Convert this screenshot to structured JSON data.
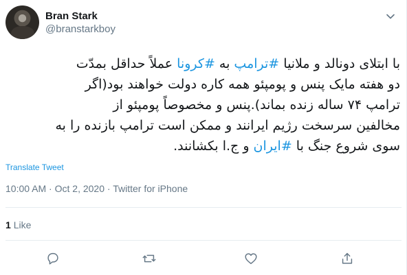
{
  "user": {
    "display_name": "Bran Stark",
    "handle": "@branstarkboy"
  },
  "tweet": {
    "line1_a": "با ابتلای دونالد و ملانیا ",
    "line1_tag1": "#ترامپ",
    "line1_b": " به ",
    "line1_tag2": "#کرونا",
    "line1_c": " عملاً حداقل بمدّت",
    "line2": "دو هفته  مایک پنس و پومپئو همه کاره دولت خواهند بود(اگر",
    "line3": "ترامپ ۷۴ ساله زنده بماند).پنس و مخصوصاً پومپئو از",
    "line4": "مخالفین سرسخت رژیم ایرانند و ممکن است ترامپ بازنده را به",
    "line5_a": "سوی شروع جنگ با ",
    "line5_tag": "#ایران",
    "line5_b": " و ج.ا بکشانند."
  },
  "translate_label": "Translate Tweet",
  "meta": {
    "time": "10:00 AM",
    "sep1": " · ",
    "date": "Oct 2, 2020",
    "sep2": " · ",
    "source": "Twitter for iPhone"
  },
  "likes": {
    "count": "1",
    "label": "Like"
  },
  "colors": {
    "link": "#1b95e0",
    "secondary_text": "#657786",
    "border": "#e6ecf0"
  },
  "icons": [
    "chevron-down-icon",
    "reply-icon",
    "retweet-icon",
    "like-icon",
    "share-icon"
  ]
}
